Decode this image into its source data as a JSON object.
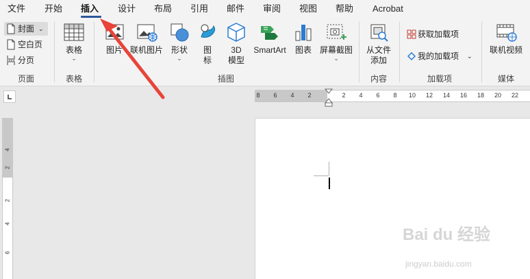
{
  "tabs": [
    "文件",
    "开始",
    "插入",
    "设计",
    "布局",
    "引用",
    "邮件",
    "审阅",
    "视图",
    "帮助",
    "Acrobat"
  ],
  "active_tab": "插入",
  "ribbon": {
    "pages": {
      "cover": "封面",
      "blank": "空白页",
      "break": "分页",
      "group": "页面"
    },
    "tables": {
      "table": "表格",
      "group": "表格"
    },
    "illustrations": {
      "picture": "图片",
      "online_picture": "联机图片",
      "shapes": "形状",
      "icons": "图\n标",
      "model3d": "3D\n模型",
      "smartart": "SmartArt",
      "chart": "图表",
      "screenshot": "屏幕截图",
      "group": "插图"
    },
    "content": {
      "from_file": "从文件\n添加",
      "group": "内容"
    },
    "addins": {
      "get": "获取加载项",
      "my": "我的加载项",
      "group": "加载项"
    },
    "media": {
      "online_video": "联机视频",
      "group": "媒体"
    }
  },
  "hruler_numbers": [
    "8",
    "6",
    "4",
    "2",
    "2",
    "4",
    "6",
    "8",
    "10",
    "12",
    "14",
    "16",
    "18",
    "20",
    "22"
  ],
  "vruler_numbers": [
    "4",
    "2",
    "2",
    "4",
    "6"
  ],
  "watermark": {
    "main": "Bai du 经验",
    "sub": "jingyan.baidu.com"
  },
  "colors": {
    "accent": "#2b579a",
    "arrow": "#e8443a",
    "ribbon_bg": "#f3f3f3",
    "canvas_bg": "#e8e8e8"
  }
}
